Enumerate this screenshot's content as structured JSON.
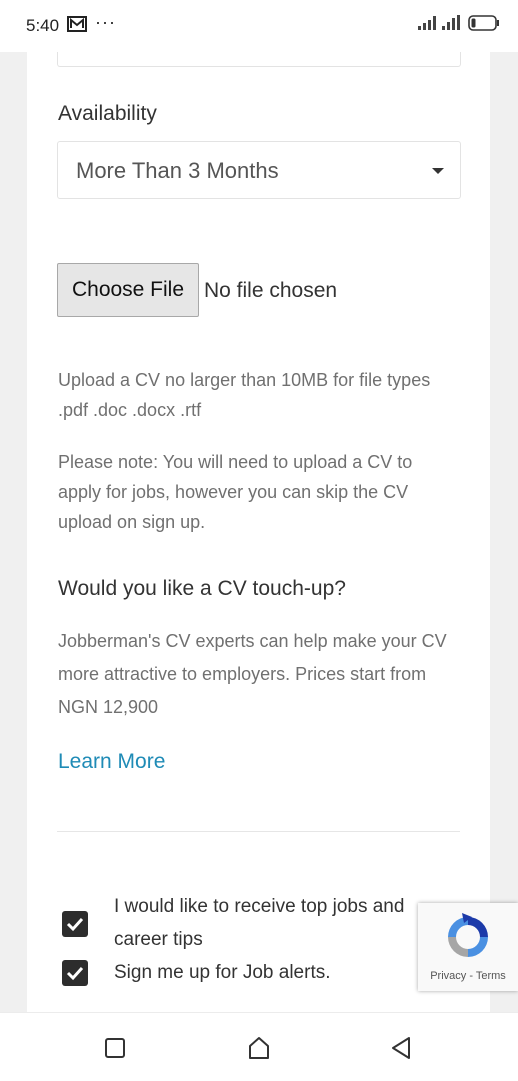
{
  "status_bar": {
    "time": "5:40",
    "icons": [
      "mail-icon",
      "more-dots-icon",
      "signal-icon",
      "signal-icon",
      "battery-icon"
    ],
    "dots": "···"
  },
  "form": {
    "availability_label": "Availability",
    "availability_value": "More Than 3 Months",
    "file_button_label": "Choose File",
    "file_status": "No file chosen",
    "upload_hint": "Upload a CV no larger than 10MB for file types .pdf .doc .docx .rtf",
    "note": "Please note: You will need to upload a CV to apply for jobs, however you can skip the CV upload on sign up.",
    "touchup_heading": "Would you like a CV touch-up?",
    "touchup_text": "Jobberman's CV experts can help make your CV more attractive to employers. Prices start from NGN 12,900",
    "learn_more": "Learn More",
    "checkbox_top_jobs": "I would like to receive top jobs and career tips",
    "checkbox_job_alerts": "Sign me up for Job alerts.",
    "checkbox_top_jobs_checked": true,
    "checkbox_job_alerts_checked": true
  },
  "recaptcha": {
    "links": "Privacy - Terms"
  },
  "nav_bar": {
    "icons": [
      "recent-apps-icon",
      "home-icon",
      "back-icon"
    ]
  },
  "colors": {
    "link": "#1f8bb6",
    "checkbox": "#2d2d2d",
    "page_bg": "#f0f0f0"
  }
}
